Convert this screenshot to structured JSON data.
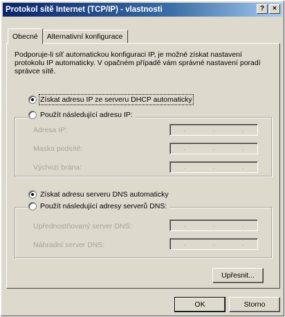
{
  "window": {
    "title": "Protokol sítě Internet (TCP/IP) - vlastnosti",
    "help_button": "?",
    "close_button": "×"
  },
  "tabs": [
    {
      "label": "Obecné",
      "active": true
    },
    {
      "label": "Alternativní konfigurace",
      "active": false
    }
  ],
  "description": "Podporuje-li síť automatickou konfiguraci IP, je možné získat nastavení protokolu IP automaticky. V opačném případě vám správné nastavení poradí správce sítě.",
  "ip_section": {
    "option_auto": {
      "label": "Získat adresu IP ze serveru DHCP automaticky",
      "selected": true
    },
    "option_manual": {
      "label": "Použít následující adresu IP:",
      "selected": false
    },
    "fields": [
      {
        "label": "Adresa IP:"
      },
      {
        "label": "Maska podsítě:"
      },
      {
        "label": "Výchozí brána:"
      }
    ]
  },
  "dns_section": {
    "option_auto": {
      "label": "Získat adresu serveru DNS automaticky",
      "selected": true
    },
    "option_manual": {
      "label": "Použít následující adresy serverů DNS:",
      "selected": false
    },
    "fields": [
      {
        "label": "Upřednostňovaný server DNS:"
      },
      {
        "label": "Náhradní server DNS:"
      }
    ]
  },
  "buttons": {
    "advanced": "Upřesnit...",
    "ok": "OK",
    "cancel": "Storno"
  },
  "ip_separator": "."
}
